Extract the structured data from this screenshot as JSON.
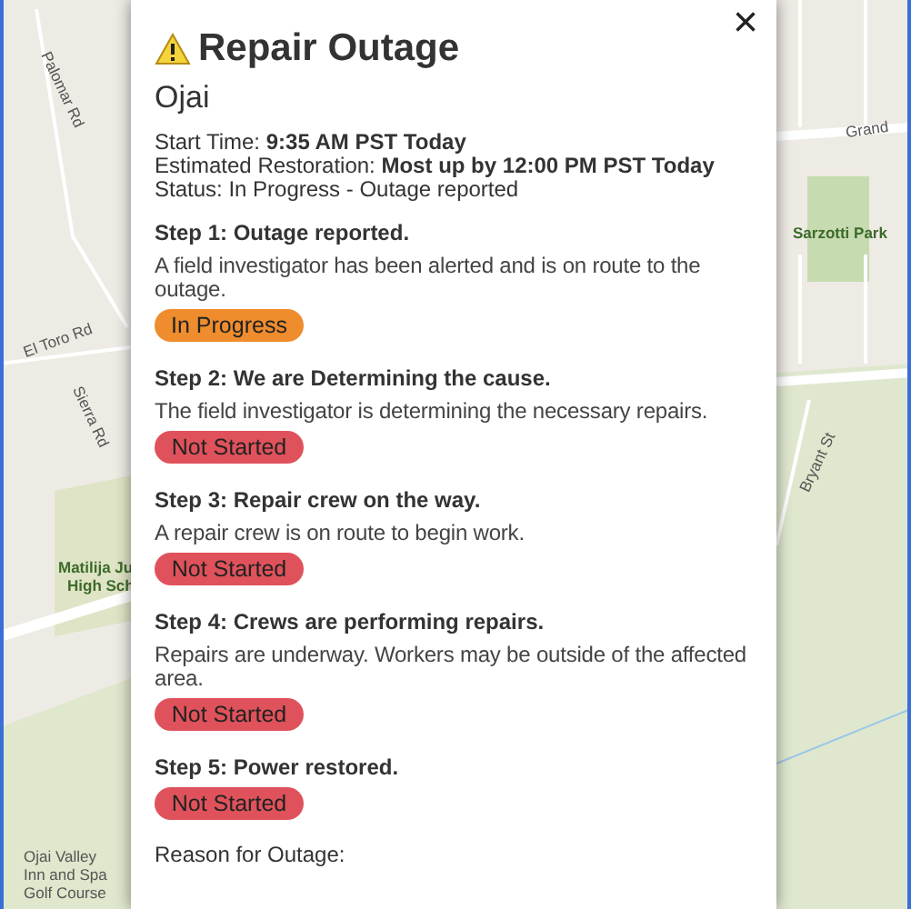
{
  "map": {
    "labels": [
      {
        "text": "Palomar Rd"
      },
      {
        "text": "El Toro Rd"
      },
      {
        "text": "Sierra Rd"
      },
      {
        "text": "Matilija Ju"
      },
      {
        "text": "High Sch"
      },
      {
        "text": "Ojai Valley"
      },
      {
        "text": "Inn and Spa"
      },
      {
        "text": "Golf Course"
      },
      {
        "text": "Grand"
      },
      {
        "text": "Sarzotti Park"
      },
      {
        "text": "Bryant St"
      }
    ]
  },
  "popup": {
    "title": "Repair Outage",
    "close": "×",
    "location": "Ojai",
    "details": [
      "Start Time: **9:35 AM PST Today**",
      "Estimated Restoration: **Most up by 12:00 PM PST Today**",
      "Status: In Progress - Outage reported"
    ],
    "steps": [
      {
        "title": "Step 1: Outage reported.",
        "description": "A field investigator has been alerted and is on route to the outage.",
        "status": "In Progress",
        "kind": "in_progress"
      },
      {
        "title": "Step 2: We are Determining the cause.",
        "description": "The field investigator is determining the necessary repairs.",
        "status": "Not Started",
        "kind": "not_started"
      },
      {
        "title": "Step 3: Repair crew on the way.",
        "description": "A repair crew is on route to begin work.",
        "status": "Not Started",
        "kind": "not_started"
      },
      {
        "title": "Step 4: Crews are performing repairs.",
        "description": "Repairs are underway. Workers may be outside of the affected area.",
        "status": "Not Started",
        "kind": "not_started"
      },
      {
        "title": "Step 5: Power restored.",
        "status": "Not Started",
        "kind": "not_started"
      }
    ],
    "reason_label": "Reason for Outage:"
  }
}
